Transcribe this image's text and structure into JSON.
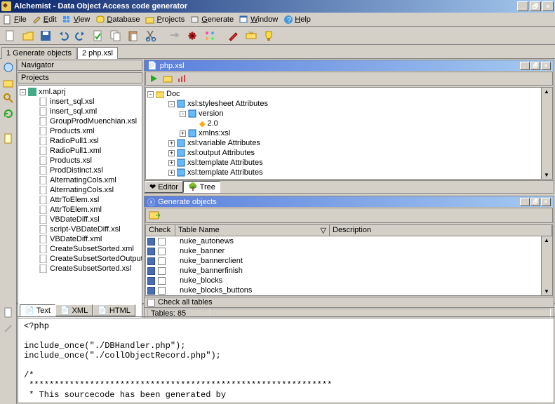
{
  "title": "Alchemist - Data  Object Access code generator",
  "menu": [
    "File",
    "Edit",
    "View",
    "Database",
    "Projects",
    "Generate",
    "Window",
    "Help"
  ],
  "documentTabs": [
    {
      "label": "1 Generate objects",
      "active": false
    },
    {
      "label": "2 php.xsl",
      "active": true
    }
  ],
  "navigator": {
    "title": "Navigator",
    "subheads": [
      "Projects"
    ]
  },
  "projectTree": {
    "root": "xml.aprj",
    "files": [
      "insert_sql.xsl",
      "insert_sql.xml",
      "GroupProdMuenchian.xsl",
      "Products.xml",
      "RadioPull1.xsl",
      "RadioPull1.xml",
      "Products.xsl",
      "ProdDistinct.xsl",
      "AlternatingCols.xml",
      "AlternatingCols.xsl",
      "AttrToElem.xsl",
      "AttrToElem.xml",
      "VBDateDiff.xsl",
      "script-VBDateDiff.xsl",
      "VBDateDiff.xml",
      "CreateSubsetSorted.xml",
      "CreateSubsetSortedOutput.xml",
      "CreateSubsetSorted.xsl"
    ]
  },
  "phpxsl": {
    "title": "php.xsl",
    "tree": {
      "root": "Doc",
      "nodes": [
        {
          "label": "xsl:stylesheet Attributes",
          "level": 1,
          "toggle": "-"
        },
        {
          "label": "version",
          "level": 2,
          "toggle": "-"
        },
        {
          "label": "2.0",
          "level": 3,
          "toggle": null,
          "dot": true
        },
        {
          "label": "xmlns:xsl",
          "level": 2,
          "toggle": "+"
        },
        {
          "label": "xsl:variable Attributes",
          "level": 1,
          "toggle": "+"
        },
        {
          "label": "xsl:output Attributes",
          "level": 1,
          "toggle": "+"
        },
        {
          "label": "xsl:template Attributes",
          "level": 1,
          "toggle": "+"
        },
        {
          "label": "xsl:template Attributes",
          "level": 1,
          "toggle": "+"
        }
      ]
    },
    "bottomTabs": [
      "Editor",
      "Tree"
    ]
  },
  "generate": {
    "title": "Generate objects",
    "columns": [
      "Check",
      "Table Name",
      "Description"
    ],
    "rows": [
      "nuke_autonews",
      "nuke_banner",
      "nuke_bannerclient",
      "nuke_bannerfinish",
      "nuke_blocks",
      "nuke_blocks_buttons"
    ],
    "checkAll": "Check all tables",
    "status": "Tables: 85"
  },
  "bottomEditor": {
    "tabs": [
      "Text",
      "XML",
      "HTML"
    ],
    "code": "<?php\n\ninclude_once(\"./DBHandler.php\");\ninclude_once(\"./collObjectRecord.php\");\n\n/*\n ************************************************************\n * This sourcecode has been generated by"
  }
}
